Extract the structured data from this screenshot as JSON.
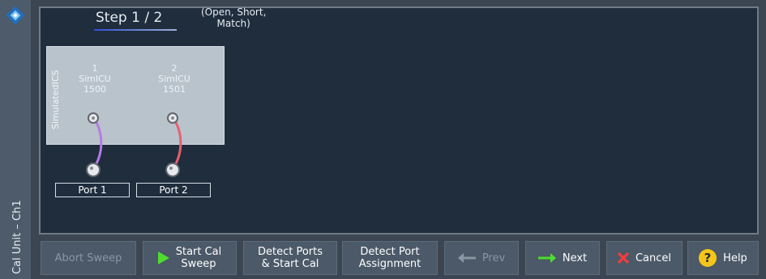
{
  "sidebar": {
    "title": "Cal Unit – Ch1"
  },
  "wizard": {
    "step_label": "Step",
    "step_current": "1 / 2",
    "step_note_line1": "(Open, Short,",
    "step_note_line2": "Match)"
  },
  "cal_unit": {
    "label": "SimulatedICS",
    "ports": [
      {
        "number": "1",
        "name": "SimICU",
        "id": "1500"
      },
      {
        "number": "2",
        "name": "SimICU",
        "id": "1501"
      }
    ]
  },
  "analyzer_ports": [
    {
      "label": "Port 1",
      "cable_color": "#b57ae6"
    },
    {
      "label": "Port 2",
      "cable_color": "#e8606e"
    }
  ],
  "buttons": {
    "abort_sweep": "Abort Sweep",
    "start_cal_sweep": "Start Cal\nSweep",
    "detect_ports_start": "Detect Ports\n& Start Cal",
    "detect_port_assignment": "Detect Port\nAssignment",
    "prev": "Prev",
    "next": "Next",
    "cancel": "Cancel",
    "help": "Help"
  },
  "colors": {
    "accent_green": "#4fdc2f",
    "cancel_red": "#ff3a3a",
    "help_yellow": "#f5c518"
  }
}
